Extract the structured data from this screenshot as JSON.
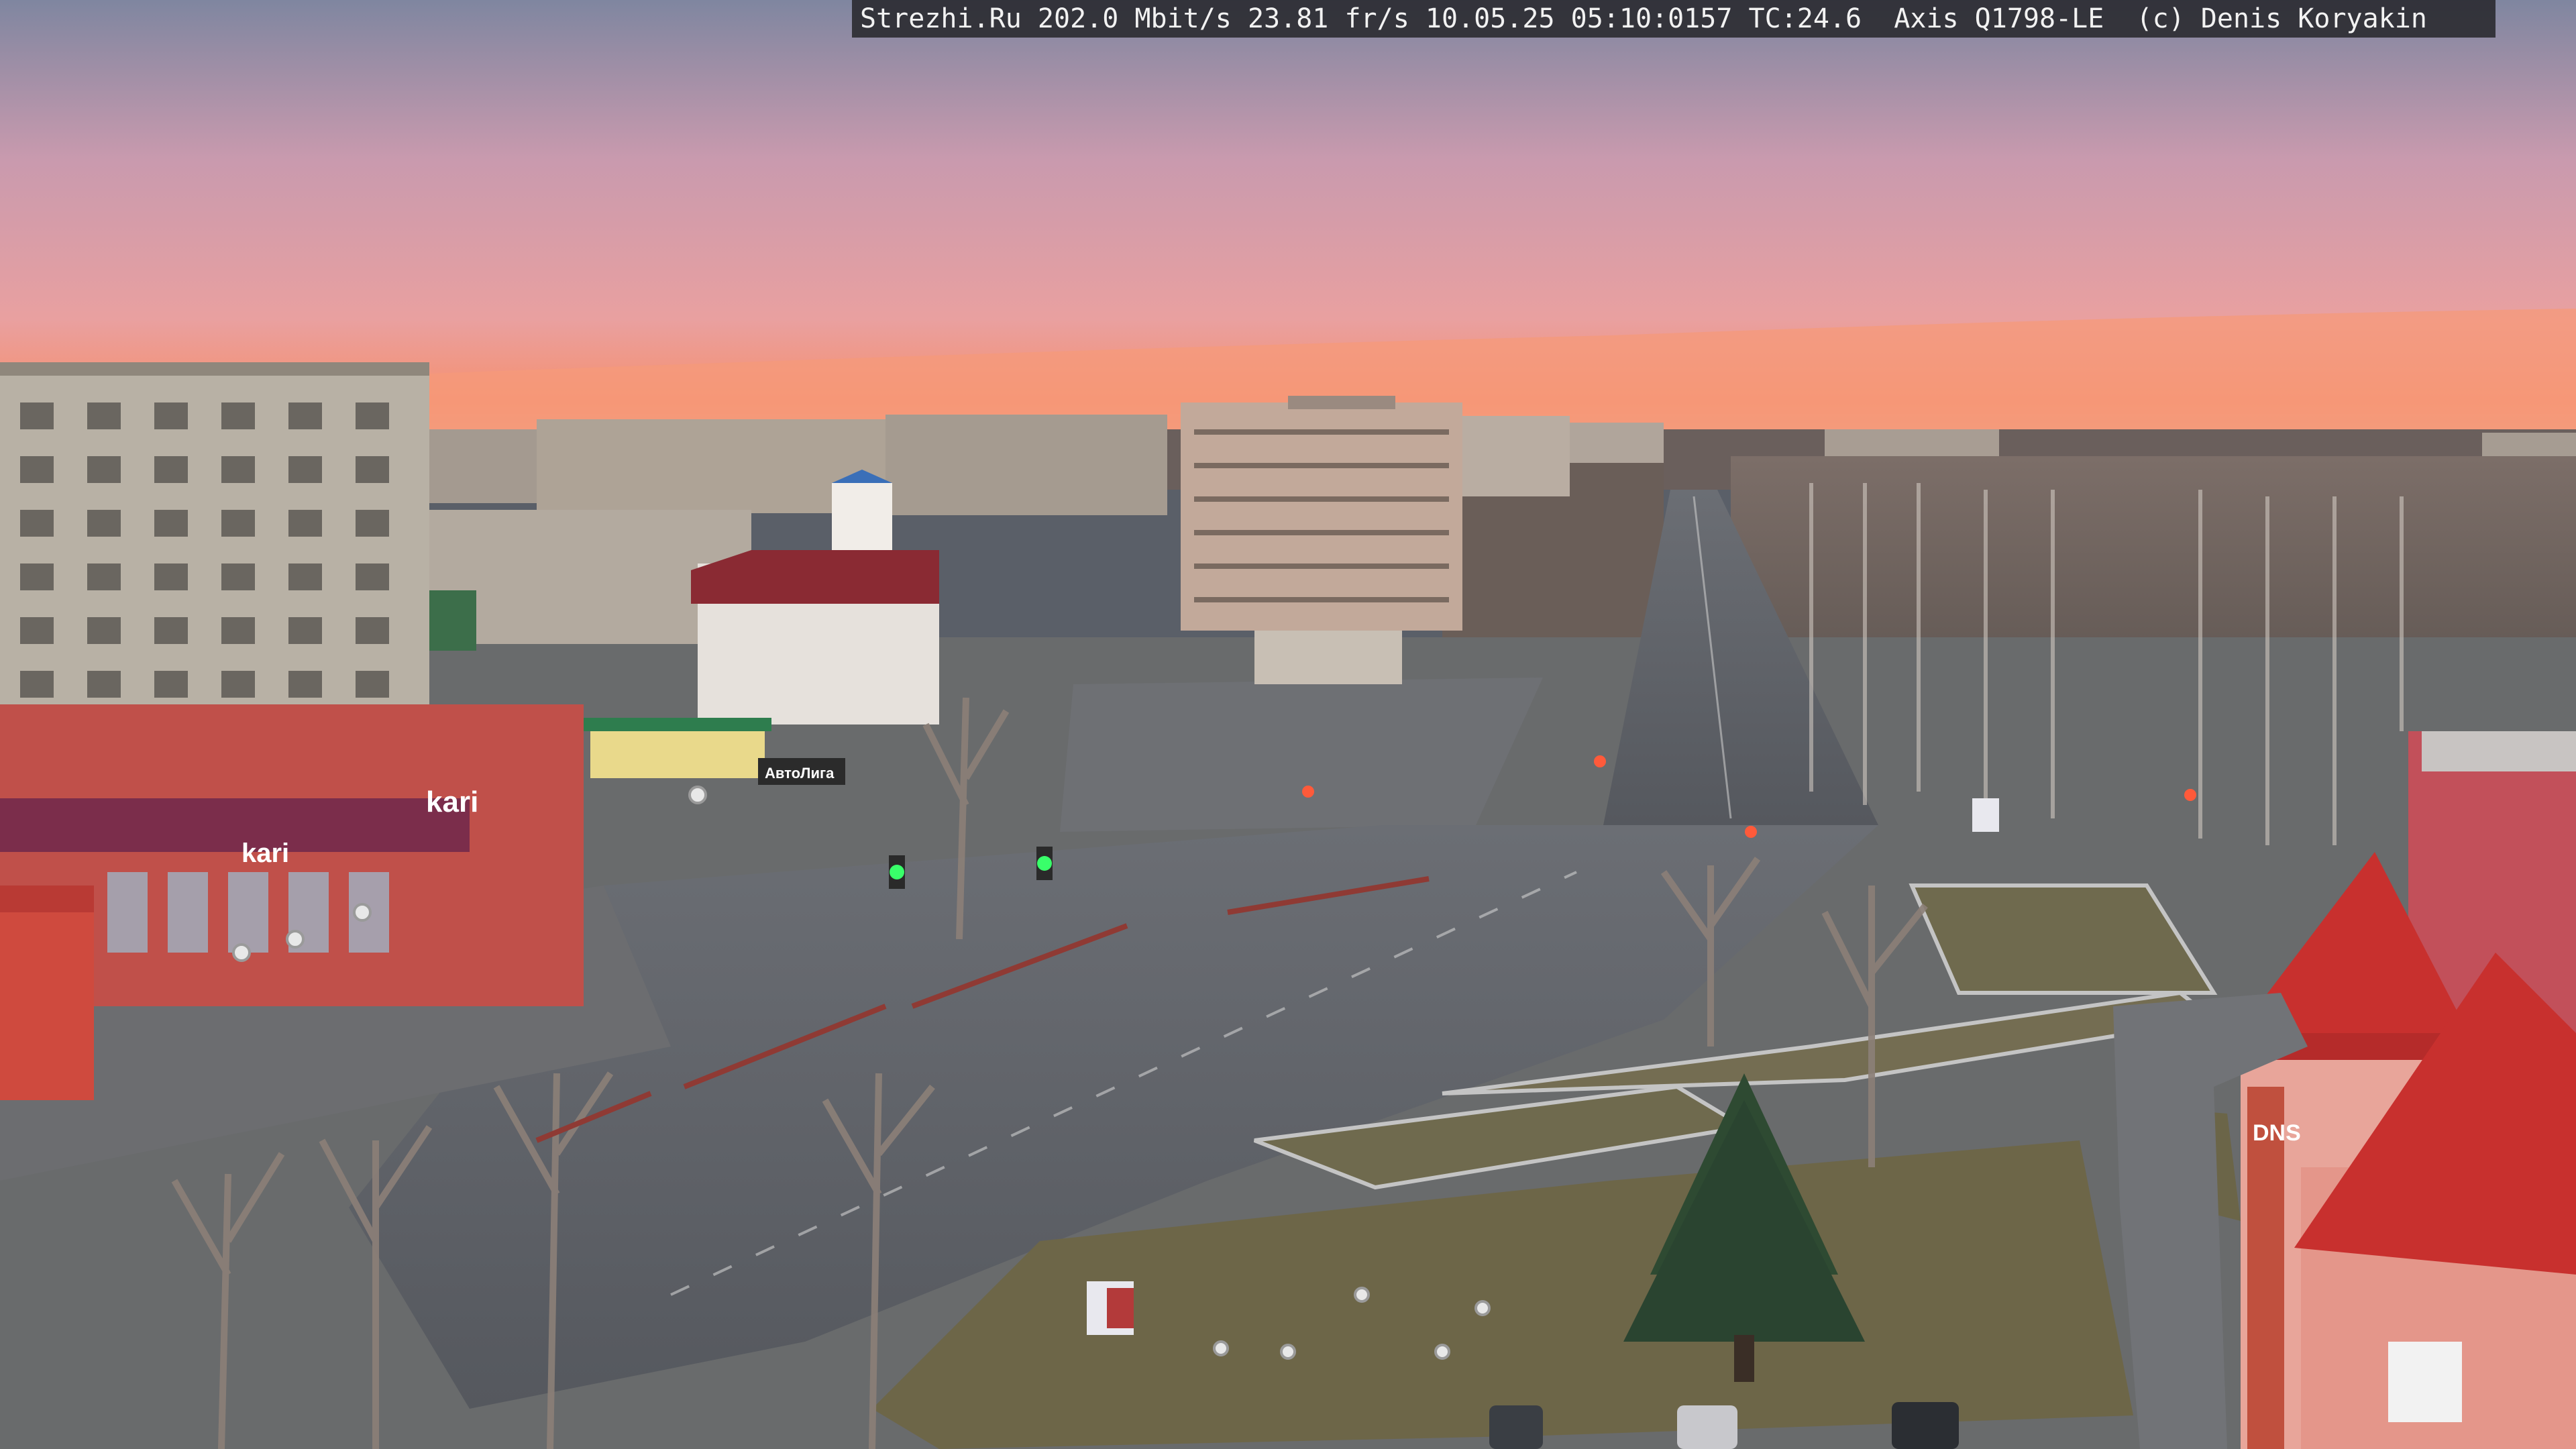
{
  "overlay": {
    "text": "Strezhi.Ru 202.0 Mbit/s 23.81 fr/s 10.05.25 05:10:0157 TC:24.6  Axis Q1798-LE  (c) Denis Koryakin"
  },
  "signs": {
    "store_main": "kari",
    "store_small": "kari",
    "bank": "",
    "shop_vertical": "DNS",
    "kiosk": "АвтоЛига"
  },
  "colors": {
    "sky_top": "#8a8fa8",
    "sky_mid": "#d89aa8",
    "horizon_glow": "#f6906f",
    "road": "#5d6168",
    "brick_building": "#c0504a",
    "red_roof": "#c8302e",
    "panel_building": "#b9b2a6",
    "grass": "#6f6a4e"
  }
}
